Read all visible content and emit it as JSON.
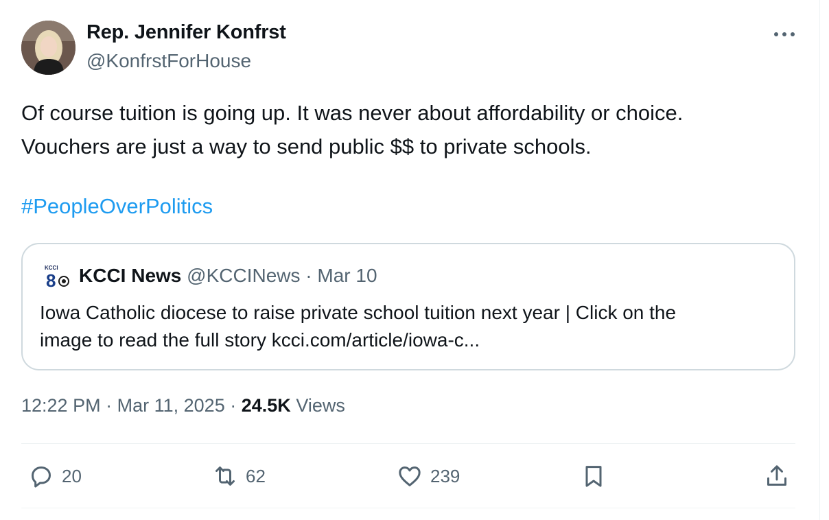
{
  "author": {
    "name": "Rep. Jennifer Konfrst",
    "handle": "@KonfrstForHouse"
  },
  "tweet": {
    "line1": "Of course tuition is going up. It was never about affordability or choice.",
    "line2": "Vouchers are just a way to send public $$ to private schools.",
    "hashtag": "#PeopleOverPolitics"
  },
  "quote": {
    "logo_text": "KCCI",
    "name": "KCCI News",
    "handle": "@KCCINews",
    "separator": "·",
    "date": "Mar 10",
    "line1": "Iowa Catholic diocese to raise private school tuition next year | Click on the",
    "line2": "image to read the full story kcci.com/article/iowa-c..."
  },
  "meta": {
    "time": "12:22 PM",
    "sep1": "·",
    "date": "Mar 11, 2025",
    "sep2": "·",
    "views_count": "24.5K",
    "views_label": "Views"
  },
  "actions": {
    "replies": "20",
    "reposts": "62",
    "likes": "239"
  },
  "icons": {
    "more": "more-horizontal-icon",
    "reply": "reply-icon",
    "repost": "repost-icon",
    "like": "heart-icon",
    "bookmark": "bookmark-icon",
    "share": "share-icon"
  },
  "colors": {
    "text": "#0f1419",
    "secondary": "#536471",
    "link": "#1d9bf0",
    "border": "#cfd9de",
    "divider": "#eff3f4"
  }
}
